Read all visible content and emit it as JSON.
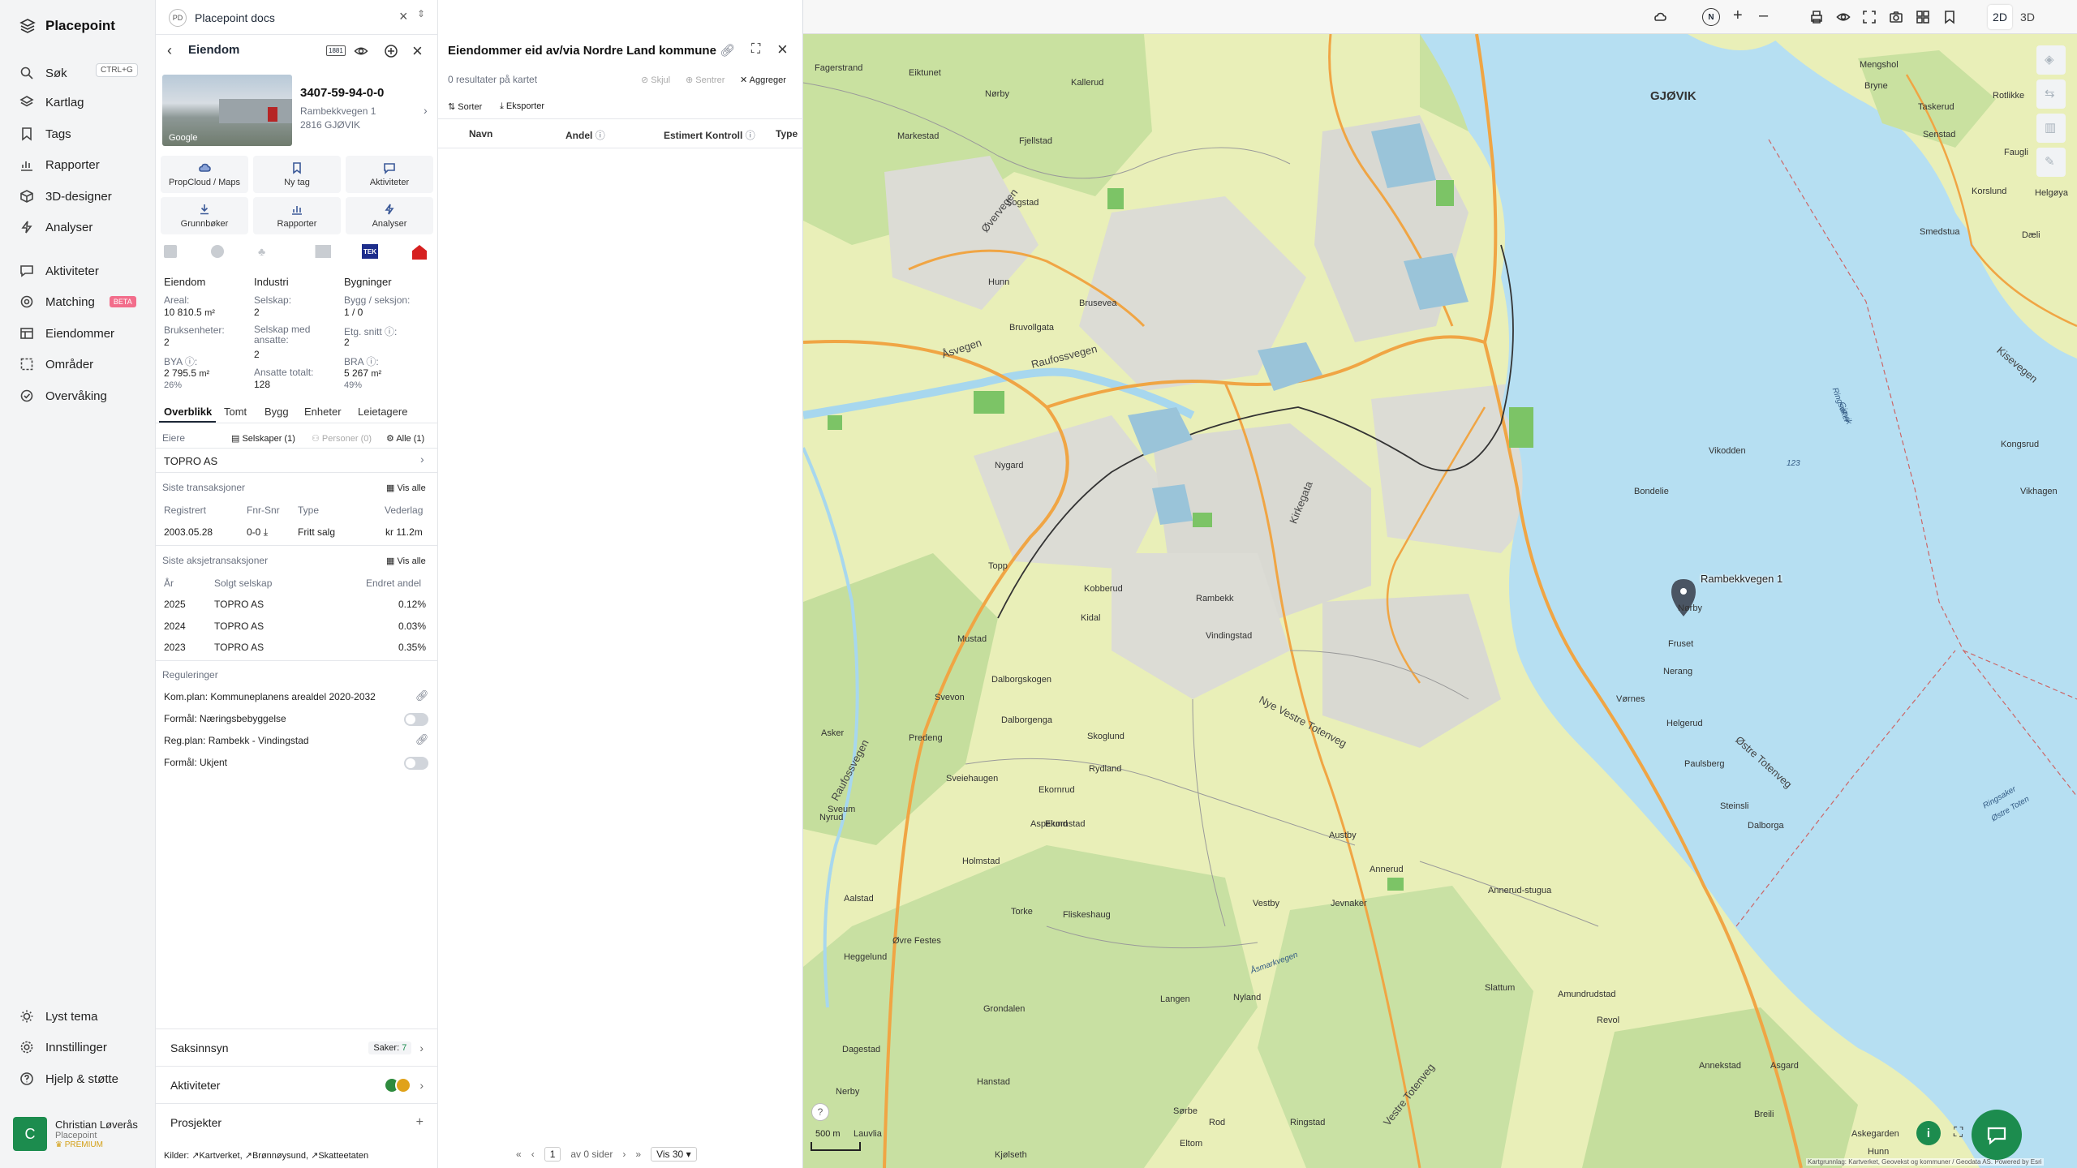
{
  "nav": {
    "brand": "Placepoint",
    "items": [
      {
        "label": "Søk",
        "icon": "search-icon"
      },
      {
        "label": "Kartlag",
        "icon": "layers-icon"
      },
      {
        "label": "Tags",
        "icon": "bookmark-icon"
      },
      {
        "label": "Rapporter",
        "icon": "chart-icon"
      },
      {
        "label": "3D-designer",
        "icon": "cube-icon"
      },
      {
        "label": "Analyser",
        "icon": "bolt-icon"
      },
      {
        "label": "Aktiviteter",
        "icon": "message-icon"
      },
      {
        "label": "Matching",
        "icon": "target-icon"
      },
      {
        "label": "Eiendommer",
        "icon": "table-icon"
      },
      {
        "label": "Områder",
        "icon": "area-icon"
      },
      {
        "label": "Overvåking",
        "icon": "monitor-icon"
      }
    ],
    "search_shortcut": "CTRL+G",
    "matching_badge": "BETA",
    "bottom": [
      {
        "label": "Lyst tema",
        "icon": "sun-icon"
      },
      {
        "label": "Innstillinger",
        "icon": "gear-icon"
      },
      {
        "label": "Hjelp & støtte",
        "icon": "help-icon"
      }
    ],
    "user": {
      "initial": "C",
      "name": "Christian Løverås",
      "org": "Placepoint",
      "plan": "PREMIUM"
    }
  },
  "workspace": {
    "badge": "PD",
    "title": "Placepoint docs"
  },
  "property": {
    "header": "Eiendom",
    "map_badge": "1881",
    "id": "3407-59-94-0-0",
    "address": "Rambekkvegen 1",
    "postal": "2816 GJØVIK",
    "photo_brand": "Google",
    "actions": [
      "PropCloud / Maps",
      "Ny tag",
      "Aktiviteter",
      "Grunnbøker",
      "Rapporter",
      "Analyser"
    ],
    "provider_tek": "TEK",
    "facts_headers": [
      "Eiendom",
      "Industri",
      "Bygninger"
    ],
    "facts": {
      "areal_label": "Areal:",
      "areal": "10 810.5",
      "unit_m2": "m²",
      "selskap_label": "Selskap:",
      "selskap": "2",
      "bygg_label": "Bygg / seksjon:",
      "bygg": "1 / 0",
      "bruks_label": "Bruksenheter:",
      "bruks": "2",
      "selskap_ans_label": "Selskap med ansatte:",
      "selskap_ans": "2",
      "etg_label": "Etg. snitt",
      "etg": "2",
      "bya_label": "BYA",
      "bya": "2 795.5",
      "bya_pct": "26%",
      "ansatte_label": "Ansatte totalt:",
      "ansatte": "128",
      "bra_label": "BRA",
      "bra": "5 267",
      "bra_pct": "49%"
    },
    "tabs": [
      "Overblikk",
      "Tomt",
      "Bygg",
      "Enheter",
      "Leietagere"
    ],
    "owners": {
      "label": "Eiere",
      "filters": [
        "Selskaper (1)",
        "Personer (0)",
        "Alle (1)"
      ],
      "name": "TOPRO AS"
    },
    "transactions": {
      "title": "Siste transaksjoner",
      "show_all": "Vis alle",
      "headers": [
        "Registrert",
        "Fnr-Snr",
        "Type",
        "Vederlag"
      ],
      "rows": [
        {
          "date": "2003.05.28",
          "fnr": "0-0",
          "type": "Fritt salg",
          "amount": "kr 11.2m"
        }
      ]
    },
    "share_tx": {
      "title": "Siste aksjetransaksjoner",
      "show_all": "Vis alle",
      "headers": [
        "År",
        "Solgt selskap",
        "Endret andel"
      ],
      "rows": [
        {
          "year": "2025",
          "company": "TOPRO AS",
          "share": "0.12%"
        },
        {
          "year": "2024",
          "company": "TOPRO AS",
          "share": "0.03%"
        },
        {
          "year": "2023",
          "company": "TOPRO AS",
          "share": "0.35%"
        }
      ]
    },
    "regulations": {
      "title": "Reguleringer",
      "komplan": "Kom.plan: Kommuneplanens arealdel 2020-2032",
      "formal1": "Formål: Næringsbebyggelse",
      "regplan": "Reg.plan: Rambekk - Vindingstad",
      "formal2": "Formål: Ukjent"
    },
    "accordions": {
      "saksinnsyn": "Saksinnsyn",
      "saker_label": "Saker:",
      "saker_count": "7",
      "aktiviteter": "Aktiviteter",
      "prosjekter": "Prosjekter"
    },
    "sources": {
      "label": "Kilder:",
      "items": [
        "Kartverket,",
        "Brønnøysund,",
        "Skatteetaten"
      ]
    }
  },
  "owned": {
    "title": "Eiendommer eid av/via Nordre Land kommune",
    "count_text": "0 resultater på kartet",
    "hide": "Skjul",
    "center": "Sentrer",
    "aggregate": "Aggreger",
    "sort": "Sorter",
    "export": "Eksporter",
    "columns": [
      "Navn",
      "Andel",
      "Estimert Kontroll",
      "Type"
    ],
    "pager": {
      "page": "1",
      "of_text": "av 0 sider",
      "per_page": "Vis 30"
    }
  },
  "map": {
    "mode_2d": "2D",
    "mode_3d": "3D",
    "compass": "N",
    "marker_label": "Rambekkvegen 1",
    "scale": "500 m",
    "attribution": "Kartgrunnlag: Kartverket, Geovekst og kommuner / Geodata AS. Powered by Esri",
    "labels": {
      "town": "GJØVIK",
      "place": [
        "Fagerstrand",
        "Eiktunet",
        "Nørby",
        "Kallerud",
        "Mengshol",
        "Rotlikke",
        "Bryne",
        "Taskerud",
        "Senstad",
        "Faugli",
        "Helgøya",
        "Dæli",
        "Korslund",
        "Smedstua",
        "Kongsrud",
        "Vikhagen",
        "Vikodden",
        "Sogstad",
        "Brusevea",
        "Bruvollgata",
        "Hunn",
        "Nygard",
        "Topp",
        "Kobberud",
        "Kidal",
        "Mustad",
        "Rambekk",
        "Vindingstad",
        "Bondelie",
        "Nørby",
        "Fruset",
        "Nerang",
        "Vørnes",
        "Helgerud",
        "Paulsberg",
        "Steinsli",
        "Dalborga",
        "Svevon",
        "Predeng",
        "Sveiehaugen",
        "Ekornrud",
        "Skoglund",
        "Rydland",
        "Ekornstad",
        "Dalborgenga",
        "Dalborgskogen",
        "Holmstad",
        "Øvre Festes",
        "Torke",
        "Aspelund",
        "Fjellstad",
        "Markestad",
        "Fliskeshaug",
        "Nyland",
        "Langen",
        "Grondalen",
        "Dagestad",
        "Hanstad",
        "Lauvlia",
        "Sørbe",
        "Eltom",
        "Kjølseth",
        "Ringstad",
        "Asker",
        "Nerby",
        "Heggelund",
        "Aalstad",
        "Vestby",
        "Austby",
        "Jevnaker",
        "Annerud",
        "Annerud-stugua",
        "Slattum",
        "Amundrudstad",
        "Revol",
        "Annekstad",
        "Asgard",
        "Breili",
        "Askegarden",
        "Hunn",
        "Nyrud",
        "Rod",
        "Sveum"
      ],
      "roads": [
        "Raufossvegen",
        "Åsvegen",
        "Øvervegen",
        "Kirkegata",
        "Nye Vestre Totenveg",
        "Østre Totenveg",
        "Kisevegen",
        "Vestre Totenveg",
        "Raufossvegen"
      ],
      "water": [
        "Ringsaker",
        "Gjøvik",
        "Ringsaker",
        "Østre Toten",
        "Åsmarkvegen",
        "123"
      ]
    }
  },
  "colors": {
    "accent": "#1c8c4e",
    "water": "#b6dff2",
    "land": "#e9efb8",
    "forest": "#c5de9d",
    "urban": "#dcdcd8",
    "road": "#f0a544"
  }
}
